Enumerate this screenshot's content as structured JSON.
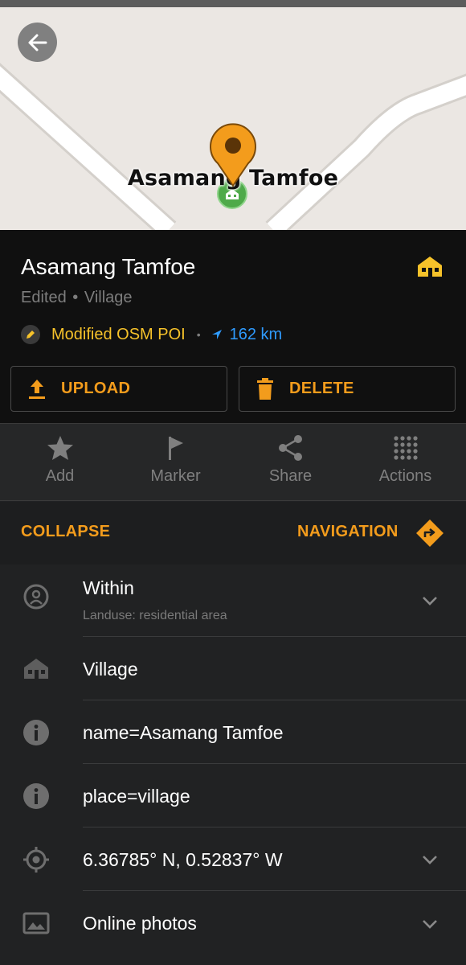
{
  "map": {
    "place_label": "Asamang Tamfoe",
    "back_icon": "arrow-left-icon",
    "colors": {
      "background": "#ebe7e3",
      "road": "#ffffff",
      "pin": "#f39c1c",
      "village_marker": "#4faa4a"
    }
  },
  "header": {
    "title": "Asamang Tamfoe",
    "subtitle_status": "Edited",
    "subtitle_separator": "•",
    "subtitle_type": "Village",
    "status_label": "Modified OSM POI",
    "status_separator": "•",
    "distance": "162 km",
    "type_icon": "house-icon"
  },
  "buttons": {
    "upload_label": "UPLOAD",
    "delete_label": "DELETE"
  },
  "actions": [
    {
      "label": "Add",
      "icon": "star-icon"
    },
    {
      "label": "Marker",
      "icon": "flag-icon"
    },
    {
      "label": "Share",
      "icon": "share-icon"
    },
    {
      "label": "Actions",
      "icon": "dots-grid-icon"
    }
  ],
  "nav": {
    "collapse_label": "COLLAPSE",
    "navigation_label": "NAVIGATION"
  },
  "details": {
    "within": {
      "title": "Within",
      "subtitle": "Landuse: residential area"
    },
    "type": "Village",
    "name_tag": "name=Asamang Tamfoe",
    "place_tag": "place=village",
    "coordinates": "6.36785° N, 0.52837° W",
    "photos": "Online photos"
  },
  "colors": {
    "accent": "#f39c1c",
    "status_yellow": "#f6c22a",
    "distance_blue": "#2f9bff",
    "panel_dark": "#101010",
    "list_bg": "#212223"
  }
}
